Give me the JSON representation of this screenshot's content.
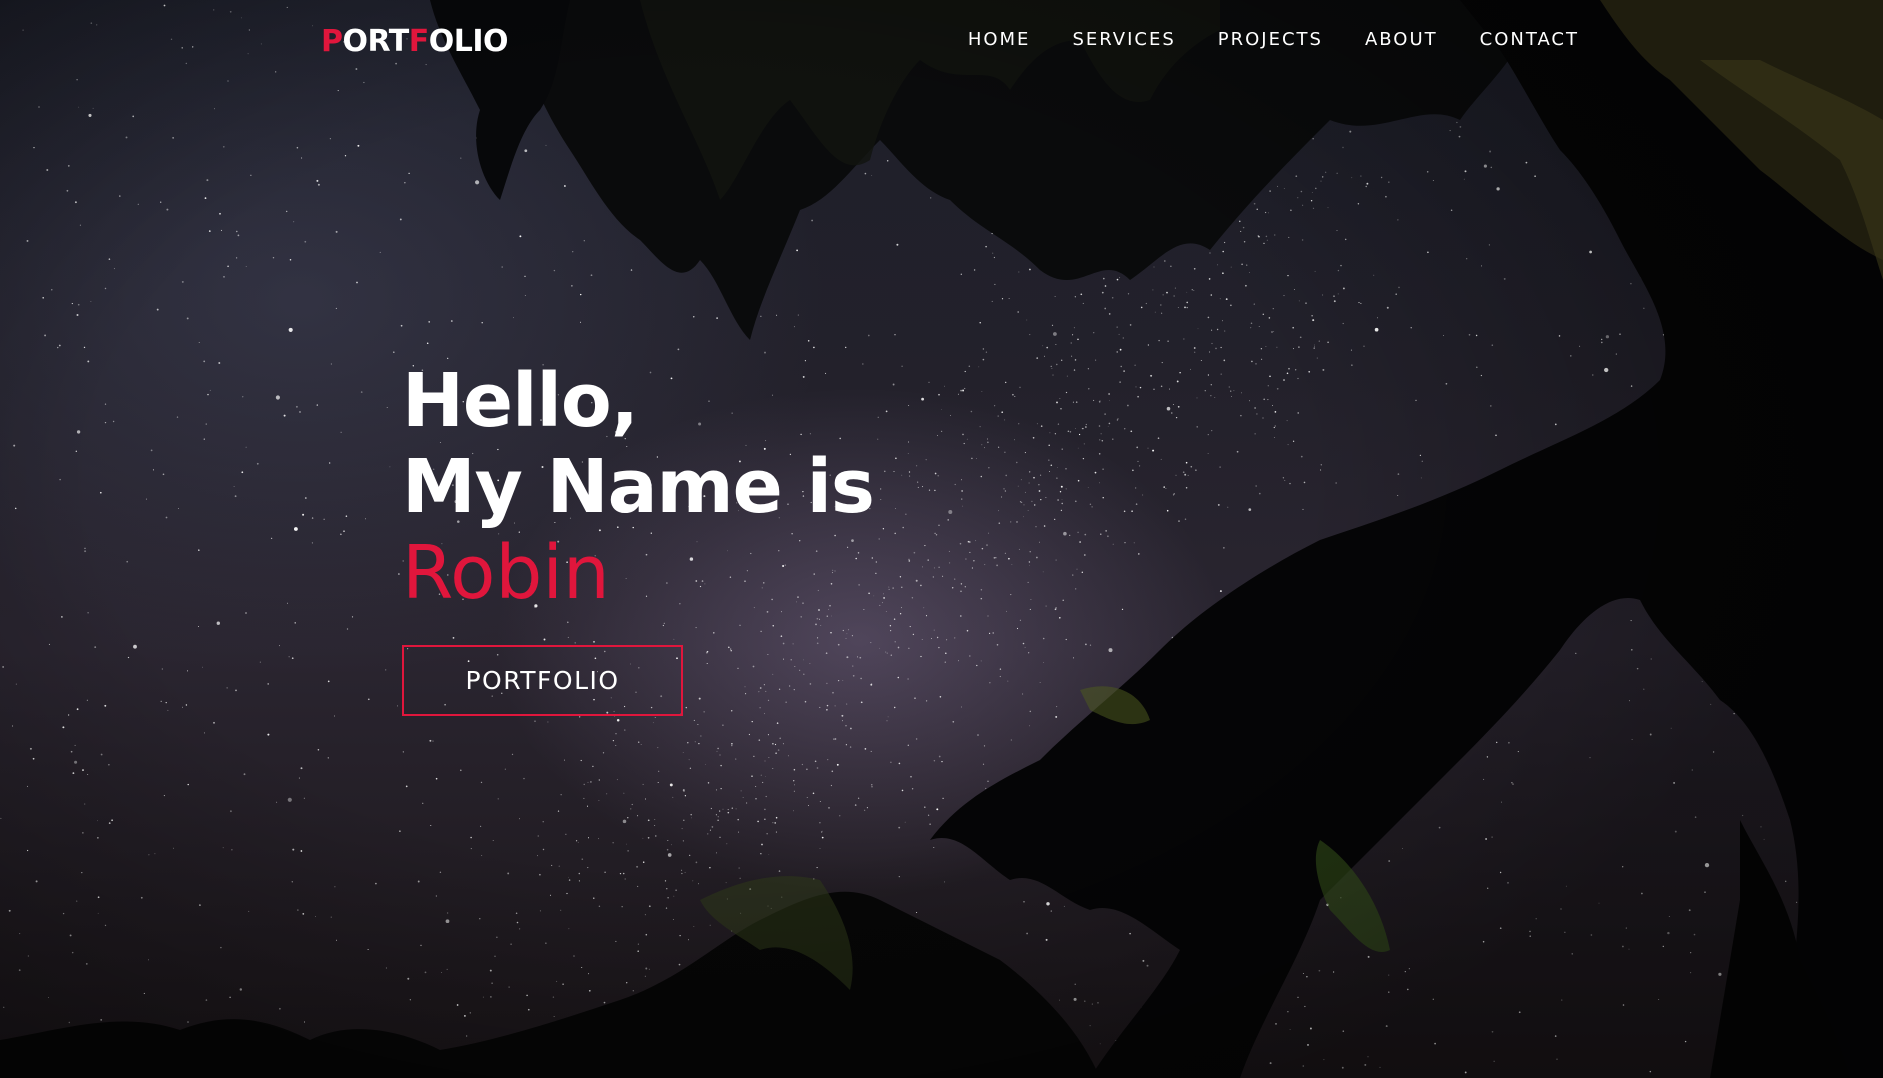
{
  "header": {
    "logo": {
      "parts": [
        {
          "text": "P",
          "accent": true
        },
        {
          "text": "ORT",
          "accent": false
        },
        {
          "text": "F",
          "accent": true
        },
        {
          "text": "OLIO",
          "accent": false
        }
      ]
    },
    "nav": [
      {
        "label": "HOME"
      },
      {
        "label": "SERVICES"
      },
      {
        "label": "PROJECTS"
      },
      {
        "label": "ABOUT"
      },
      {
        "label": "CONTACT"
      }
    ]
  },
  "hero": {
    "greeting": "Hello,",
    "line2": "My Name is",
    "name": "Robin",
    "button_label": "PORTFOLIO",
    "background": "starry night sky framed by tree silhouettes"
  },
  "colors": {
    "accent": "#e0163c",
    "text": "#ffffff",
    "sky": "#23212b"
  }
}
